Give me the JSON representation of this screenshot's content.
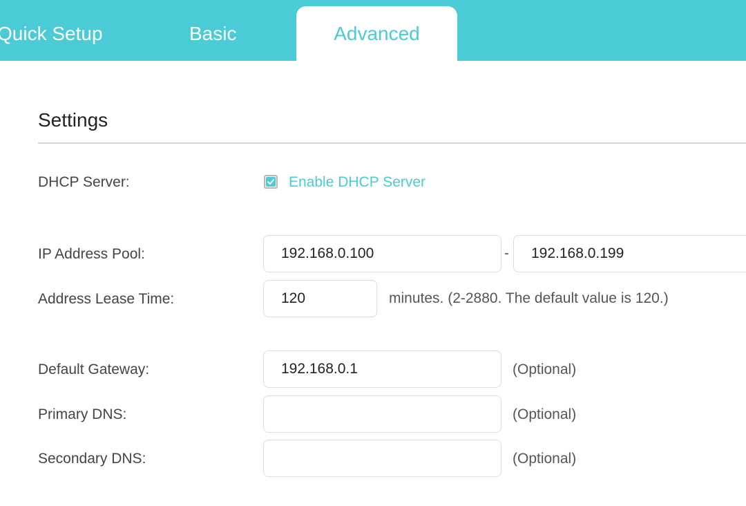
{
  "tabs": {
    "quick_setup": "Quick Setup",
    "basic": "Basic",
    "advanced": "Advanced",
    "active": "Advanced"
  },
  "settings": {
    "title": "Settings",
    "dhcp_server": {
      "label": "DHCP Server:",
      "checkbox_label": "Enable DHCP Server",
      "checked": true
    },
    "ip_pool": {
      "label": "IP Address Pool:",
      "start": "192.168.0.100",
      "separator": "-",
      "end": "192.168.0.199"
    },
    "lease_time": {
      "label": "Address Lease Time:",
      "value": "120",
      "hint": "minutes. (2-2880. The default value is 120.)"
    },
    "gateway": {
      "label": "Default Gateway:",
      "value": "192.168.0.1",
      "hint": "(Optional)"
    },
    "primary_dns": {
      "label": "Primary DNS:",
      "value": "",
      "hint": "(Optional)"
    },
    "secondary_dns": {
      "label": "Secondary DNS:",
      "value": "",
      "hint": "(Optional)"
    }
  },
  "colors": {
    "accent": "#4acbd6",
    "divider": "#d6d6d6"
  },
  "icons": {
    "checkbox": "checkmark-icon"
  }
}
